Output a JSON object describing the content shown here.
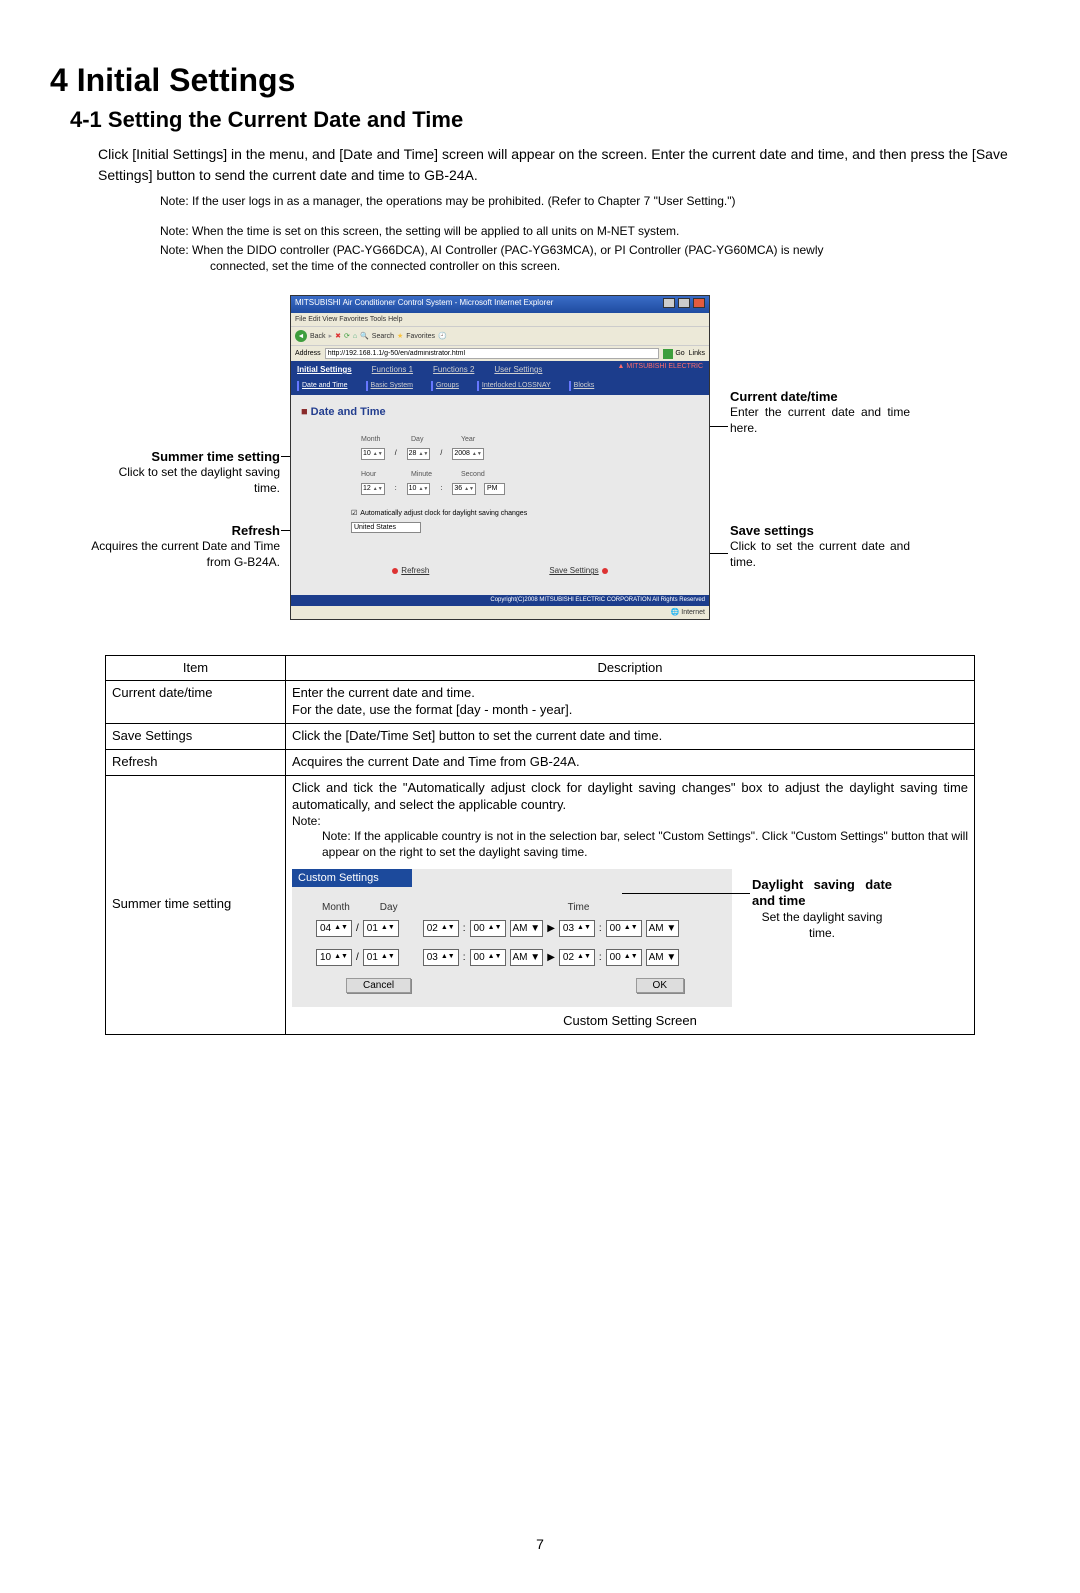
{
  "heading": {
    "title": "4 Initial Settings",
    "subtitle": "4-1 Setting the Current Date and Time"
  },
  "intro": "Click [Initial Settings] in the menu, and [Date and Time] screen will appear on the screen. Enter the current date and time, and then press the [Save Settings] button to send the current date and time to GB-24A.",
  "note1": "Note: If the user logs in as a manager, the operations may be prohibited. (Refer to Chapter 7 \"User Setting.\")",
  "note2": "Note: When the time is set on this screen, the setting will be applied to all units on M-NET system.",
  "note3a": "Note: When the DIDO controller (PAC-YG66DCA), AI Controller (PAC-YG63MCA), or PI Controller (PAC-YG60MCA) is newly",
  "note3b": "connected, set the time of the connected controller on this screen.",
  "ie": {
    "title": "MITSUBISHI Air Conditioner Control System - Microsoft Internet Explorer",
    "menu": "File   Edit   View   Favorites   Tools   Help",
    "back": "Back",
    "search": "Search",
    "favorites": "Favorites",
    "addrlabel": "Address",
    "url": "http://192.168.1.1/g-50/en/administrator.html",
    "go": "Go",
    "links": "Links",
    "internet": "Internet"
  },
  "apptabs": {
    "t1": "Initial Settings",
    "t2": "Functions 1",
    "t3": "Functions 2",
    "t4": "User Settings",
    "s1": "Date and Time",
    "s2": "Basic System",
    "s3": "Groups",
    "s4": "Interlocked LOSSNAY",
    "s5": "Blocks",
    "logo": "MITSUBISHI\nELECTRIC"
  },
  "appbody": {
    "header": "Date and Time",
    "month": "Month",
    "day": "Day",
    "year": "Year",
    "hour": "Hour",
    "minute": "Minute",
    "second": "Second",
    "monthv": "10",
    "dayv": "28",
    "yearv": "2008",
    "hourv": "12",
    "minutev": "10",
    "secondv": "36",
    "pm": "PM",
    "autocheck": "Automatically adjust clock for daylight saving changes",
    "country": "United States",
    "refresh": "Refresh",
    "save": "Save Settings",
    "copyright": "Copyright(C)2008 MITSUBISHI ELECTRIC CORPORATION All Rights Reserved"
  },
  "callouts": {
    "summer_title": "Summer time setting",
    "summer_text": "Click to set the daylight saving time.",
    "refresh_title": "Refresh",
    "refresh_text": "Acquires the current Date and Time from G-B24A.",
    "current_title": "Current date/time",
    "current_text": "Enter the current date and time here.",
    "savesettings_title": "Save settings",
    "savesettings_text": "Click to set the current date and time.",
    "daylight_title": "Daylight saving date and time",
    "daylight_text": "Set the daylight saving time."
  },
  "table": {
    "h1": "Item",
    "h2": "Description",
    "r1a": "Current date/time",
    "r1b1": "Enter the current date and time.",
    "r1b2": "For the date, use the format [day - month - year].",
    "r2a": "Save Settings",
    "r2b": "Click the [Date/Time Set] button to set the current date and time.",
    "r3a": "Refresh",
    "r3b": "Acquires the current Date and Time from GB-24A.",
    "r4a": "Summer time setting",
    "r4b1": "Click and tick the \"Automatically adjust clock for daylight saving changes\" box to adjust the daylight saving time automatically, and select the applicable country.",
    "r4b2": "Note: If the applicable country is not in the selection bar, select \"Custom Settings\". Click \"Custom Settings\" button that will appear on the right to set the daylight saving time."
  },
  "custom": {
    "title": "Custom Settings",
    "month": "Month",
    "day": "Day",
    "time": "Time",
    "row1": {
      "m": "04",
      "d": "01",
      "h1": "02",
      "mi1": "00",
      "ap1": "AM",
      "h2": "03",
      "mi2": "00",
      "ap2": "AM"
    },
    "row2": {
      "m": "10",
      "d": "01",
      "h1": "03",
      "mi1": "00",
      "ap1": "AM",
      "h2": "02",
      "mi2": "00",
      "ap2": "AM"
    },
    "cancel": "Cancel",
    "ok": "OK",
    "caption": "Custom Setting Screen"
  },
  "page": "7"
}
